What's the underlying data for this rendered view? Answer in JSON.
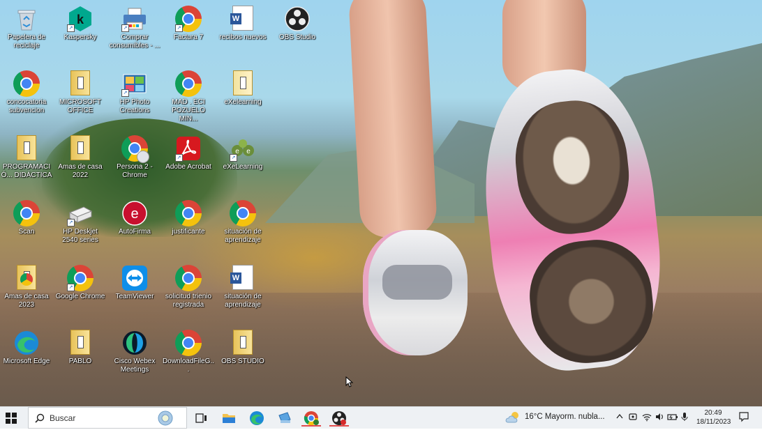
{
  "desktop": {
    "icons": [
      {
        "label": "Papelera de reciclaje",
        "type": "recycle-bin"
      },
      {
        "label": "Kaspersky",
        "type": "kaspersky"
      },
      {
        "label": "Comprar consumibles - ...",
        "type": "printer"
      },
      {
        "label": "Factura 7",
        "type": "chrome"
      },
      {
        "label": "recibos nuevos",
        "type": "word"
      },
      {
        "label": "OBS Studio",
        "type": "obs"
      },
      {
        "label": "concocatoria subvencion",
        "type": "chrome"
      },
      {
        "label": "MICROSOFT OFFICE",
        "type": "folder"
      },
      {
        "label": "HP Photo Creations",
        "type": "photo"
      },
      {
        "label": "MAD . ECI POZUELO MIN...",
        "type": "chrome"
      },
      {
        "label": "eXelearning",
        "type": "folder"
      },
      {
        "label": "PROGRAMACIÓ... DIDÁCTICA",
        "type": "folder"
      },
      {
        "label": "Amas de casa 2022",
        "type": "folder"
      },
      {
        "label": "Persona 2 - Chrome",
        "type": "chrome-profile"
      },
      {
        "label": "Adobe Acrobat",
        "type": "acrobat"
      },
      {
        "label": "eXeLearning",
        "type": "exe"
      },
      {
        "label": "Scan",
        "type": "chrome"
      },
      {
        "label": "HP Deskjet 2540 series",
        "type": "hp-printer"
      },
      {
        "label": "AutoFirma",
        "type": "autofirma"
      },
      {
        "label": "justificante",
        "type": "chrome"
      },
      {
        "label": "situación de aprendizaje",
        "type": "chrome"
      },
      {
        "label": "Amas de casa 2023",
        "type": "folder-chrome"
      },
      {
        "label": "Google Chrome",
        "type": "chrome"
      },
      {
        "label": "TeamViewer",
        "type": "teamviewer"
      },
      {
        "label": "solicitud trienio registrada",
        "type": "chrome"
      },
      {
        "label": "situación de aprendizaje",
        "type": "word"
      },
      {
        "label": "Microsoft Edge",
        "type": "edge"
      },
      {
        "label": "PABLO",
        "type": "folder"
      },
      {
        "label": "Cisco Webex Meetings",
        "type": "webex"
      },
      {
        "label": "DownloadFileG...",
        "type": "chrome"
      },
      {
        "label": "OBS STUDIO",
        "type": "folder"
      }
    ]
  },
  "taskbar": {
    "search_placeholder": "Buscar",
    "weather": "16°C  Mayorm. nubla...",
    "time": "20:49",
    "date": "18/11/2023"
  },
  "colors": {
    "taskbar": "#eef1f4",
    "accent": "#0078d4"
  }
}
